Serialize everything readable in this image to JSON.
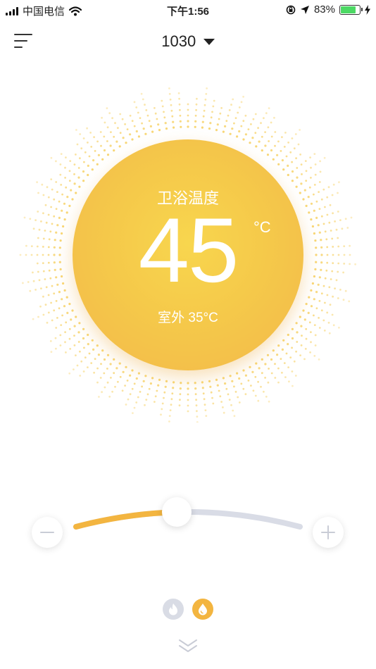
{
  "status_bar": {
    "carrier": "中国电信",
    "time": "下午1:56",
    "battery_percent_text": "83%",
    "battery_level": 0.83,
    "icons": [
      "signal-icon",
      "wifi-icon",
      "orientation-lock-icon",
      "location-icon",
      "battery-icon",
      "charging-icon"
    ]
  },
  "header": {
    "device_name": "1030",
    "menu_icon": "menu-icon",
    "dropdown_icon": "caret-down-icon"
  },
  "dial": {
    "label": "卫浴温度",
    "temperature": "45",
    "unit": "°C",
    "outdoor": "室外 35°C",
    "color": "#f5c94a"
  },
  "slider": {
    "level": 0.45,
    "active_color": "#f3b540",
    "track_color": "#d9dce6",
    "minus_icon": "minus-icon",
    "plus_icon": "plus-icon"
  },
  "modes": [
    {
      "icon": "flame-icon",
      "active": false
    },
    {
      "icon": "water-drop-icon",
      "active": true
    }
  ],
  "footer": {
    "icon": "double-chevron-down-icon"
  }
}
